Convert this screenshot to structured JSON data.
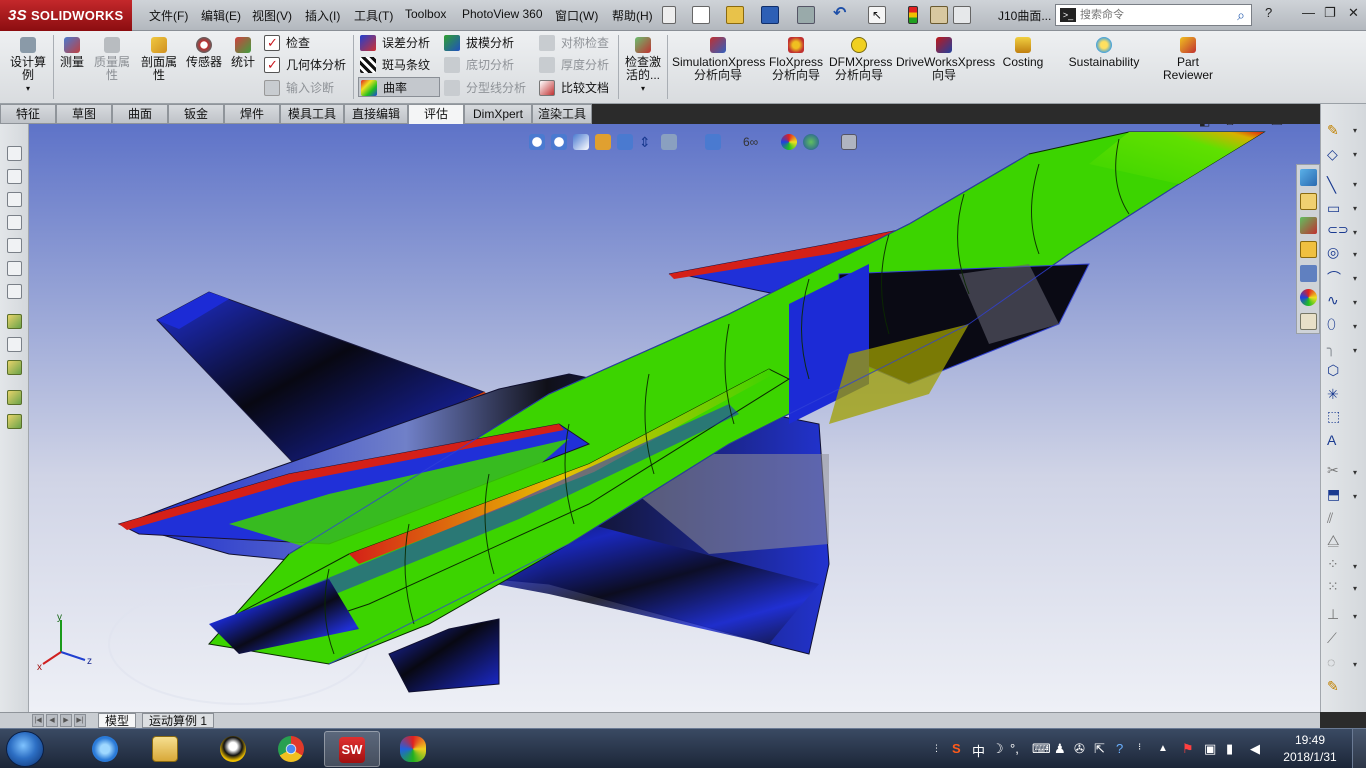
{
  "app": {
    "logo_text": "SOLIDWORKS",
    "logo_prefix": "3S",
    "document_title": "J10曲面..."
  },
  "menu": [
    {
      "id": "file",
      "label": "文件(F)"
    },
    {
      "id": "edit",
      "label": "编辑(E)"
    },
    {
      "id": "view",
      "label": "视图(V)"
    },
    {
      "id": "insert",
      "label": "插入(I)"
    },
    {
      "id": "tools",
      "label": "工具(T)"
    },
    {
      "id": "toolbox",
      "label": "Toolbox"
    },
    {
      "id": "photoview",
      "label": "PhotoView 360"
    },
    {
      "id": "window",
      "label": "窗口(W)"
    },
    {
      "id": "help",
      "label": "帮助(H)"
    }
  ],
  "search": {
    "placeholder": "搜索命令"
  },
  "window_controls": {
    "help": "?",
    "minimize": "—",
    "restore": "❐",
    "close": "✕"
  },
  "command_manager": {
    "design_study": "设计算例",
    "measure": "测量",
    "mass_properties": "质量属性",
    "section_properties": "剖面属性",
    "sensor": "传感器",
    "statistics": "统计",
    "check": "检查",
    "geometry_analysis": "几何体分析",
    "import_diagnostics": "输入诊断",
    "deviation_analysis": "误差分析",
    "zebra_stripes": "斑马条纹",
    "curvature": "曲率",
    "draft_analysis": "拔模分析",
    "undercut_analysis": "底切分析",
    "parting_line_analysis": "分型线分析",
    "symmetry_check": "对称检查",
    "thickness_analysis": "厚度分析",
    "compare_documents": "比较文档",
    "check_active": "检查激活的...",
    "simulation_xpress": "SimulationXpress 分析向导",
    "floxpress": "FloXpress 分析向导",
    "dfmxpress": "DFMXpress 分析向导",
    "driveworks": "DriveWorksXpress 向导",
    "costing": "Costing",
    "sustainability": "Sustainability",
    "part_reviewer": "Part Reviewer"
  },
  "tabs": [
    {
      "id": "features",
      "label": "特征"
    },
    {
      "id": "sketch",
      "label": "草图"
    },
    {
      "id": "surfaces",
      "label": "曲面"
    },
    {
      "id": "sheetmetal",
      "label": "钣金"
    },
    {
      "id": "weldments",
      "label": "焊件"
    },
    {
      "id": "moldtools",
      "label": "模具工具"
    },
    {
      "id": "directedit",
      "label": "直接编辑"
    },
    {
      "id": "evaluate",
      "label": "评估",
      "active": true
    },
    {
      "id": "dimxpert",
      "label": "DimXpert"
    },
    {
      "id": "render",
      "label": "渲染工具"
    }
  ],
  "bottom_tabs": [
    {
      "id": "model",
      "label": "模型",
      "active": true
    },
    {
      "id": "motion",
      "label": "运动算例 1"
    }
  ],
  "triad": {
    "x": "x",
    "y": "y",
    "z": "z"
  },
  "colors": {
    "viewport_top": "#5e73c8",
    "viewport_bottom": "#eef0f6",
    "curvature_green": "#3cd400",
    "curvature_blue": "#1c2bd6",
    "curvature_red": "#d42018",
    "curvature_black": "#050510",
    "solidworks_red": "#c4282b"
  },
  "taskbar": {
    "apps": [
      "start",
      "ie",
      "explorer",
      "qq",
      "chrome",
      "solidworks",
      "paint"
    ],
    "active_app": "solidworks"
  },
  "tray": {
    "ime": "中",
    "time": "19:49",
    "date": "2018/1/31"
  }
}
